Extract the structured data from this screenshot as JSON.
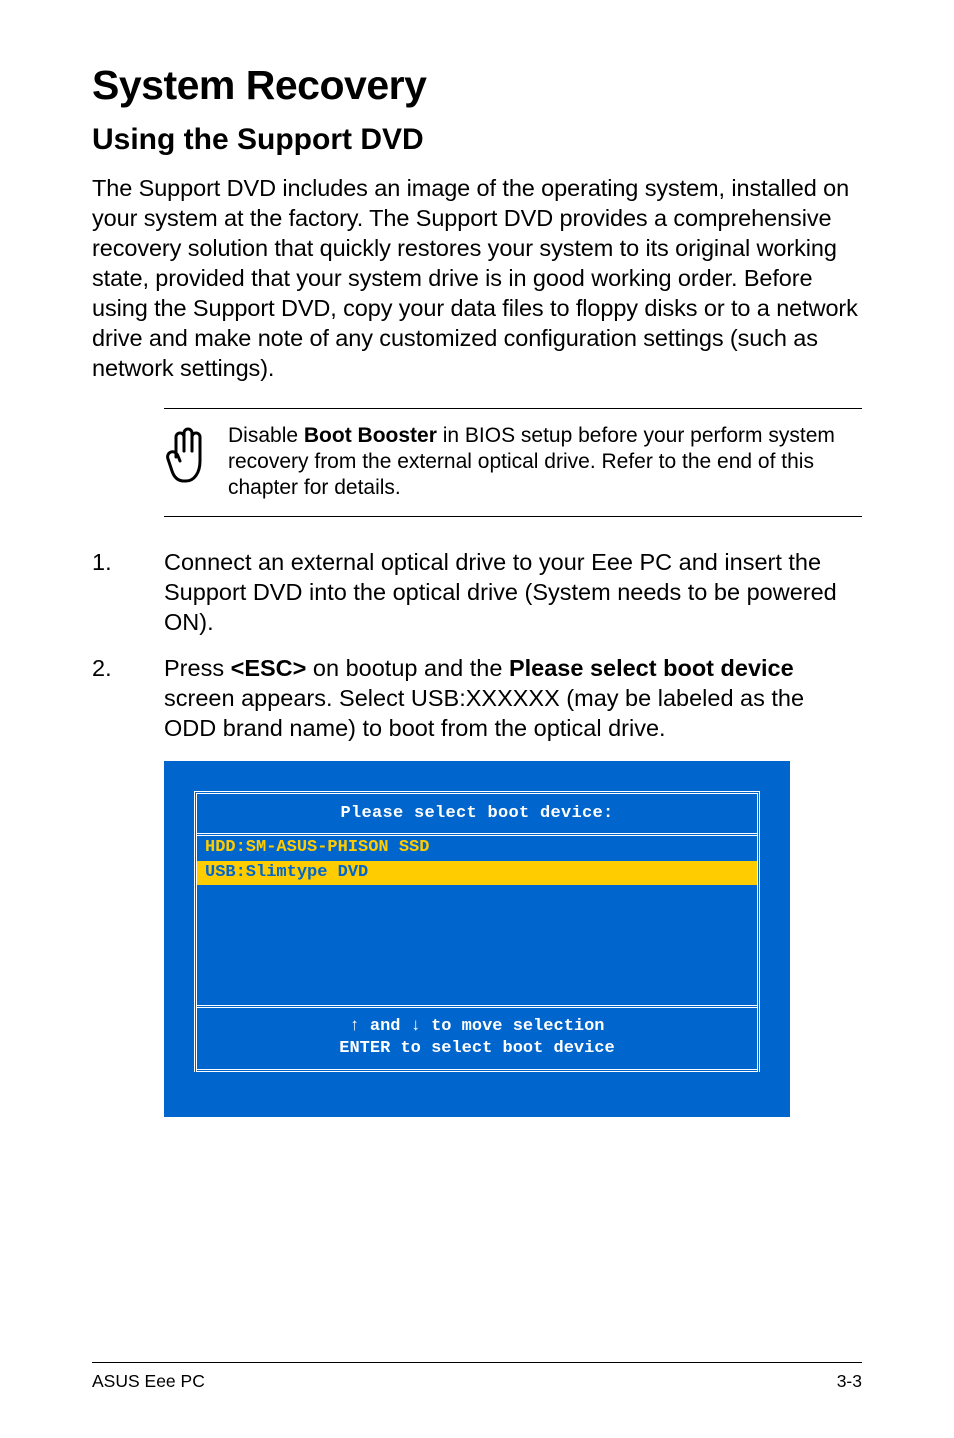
{
  "heading": "System Recovery",
  "subheading": "Using the Support DVD",
  "intro": "The Support DVD includes an image of the operating system, installed on your system at the factory. The Support DVD provides a comprehensive recovery solution that quickly restores your system to its original working state, provided that your system drive is in good working order. Before using the Support DVD, copy your data files to floppy disks or to a network drive and make note of any customized configuration settings (such as network settings).",
  "note": {
    "prefix": "Disable ",
    "bold": "Boot Booster",
    "suffix": " in BIOS setup before your perform system recovery from the external optical drive. Refer to the end of this chapter for details."
  },
  "steps": [
    {
      "text": "Connect an external optical drive to your Eee PC and insert the Support DVD into the optical drive (System needs to be powered ON)."
    },
    {
      "pre": "Press ",
      "b1": "<ESC>",
      "mid": " on bootup and the ",
      "b2": "Please select boot device",
      "post": " screen appears. Select USB:XXXXXX (may be labeled as the ODD brand name) to boot from the optical drive."
    }
  ],
  "boot": {
    "title": "Please select boot device:",
    "items": [
      {
        "label": "HDD:SM-ASUS-PHISON SSD",
        "selected": false
      },
      {
        "label": "USB:Slimtype DVD",
        "selected": true
      }
    ],
    "help1": "↑ and ↓ to move selection",
    "help2": "ENTER to select boot device"
  },
  "footer": {
    "left": "ASUS Eee PC",
    "right": "3-3"
  }
}
